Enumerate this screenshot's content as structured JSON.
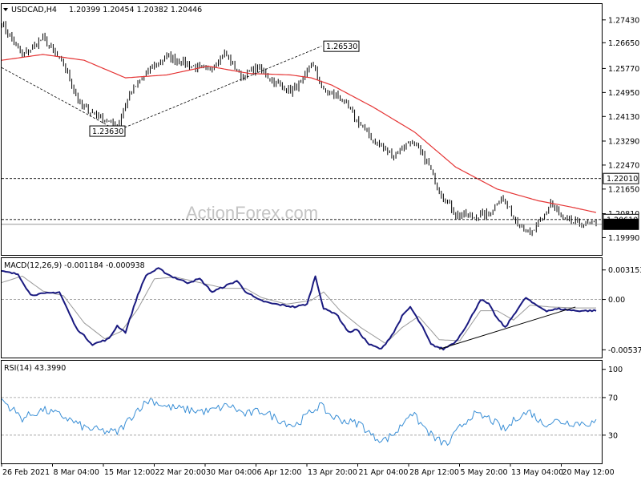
{
  "header": {
    "symbol": "USDCAD,H4",
    "ohlc": "1.20399 1.20454 1.20382 1.20446"
  },
  "watermark": "ActionForex.com",
  "chart_data": [
    {
      "type": "candlestick",
      "ylim": [
        1.194,
        1.28
      ],
      "y_ticks": [
        "1.27430",
        "1.26650",
        "1.25770",
        "1.24950",
        "1.24130",
        "1.23290",
        "1.22470",
        "1.21650",
        "1.20810",
        "1.19990"
      ],
      "y_tick_values": [
        1.2743,
        1.2665,
        1.2577,
        1.2495,
        1.2413,
        1.2329,
        1.2247,
        1.2165,
        1.2081,
        1.1999
      ],
      "x_labels": [
        "26 Feb 2021",
        "8 Mar 04:00",
        "15 Mar 12:00",
        "22 Mar 20:00",
        "30 Mar 04:00",
        "6 Apr 12:00",
        "13 Apr 20:00",
        "21 Apr 04:00",
        "28 Apr 12:00",
        "5 May 20:00",
        "13 May 04:00",
        "20 May 12:00"
      ],
      "price_waypoints": [
        [
          0,
          1.273
        ],
        [
          10,
          1.262
        ],
        [
          20,
          1.268
        ],
        [
          30,
          1.259
        ],
        [
          38,
          1.245
        ],
        [
          48,
          1.241
        ],
        [
          56,
          1.238
        ],
        [
          62,
          1.249
        ],
        [
          70,
          1.256
        ],
        [
          80,
          1.262
        ],
        [
          90,
          1.259
        ],
        [
          100,
          1.257
        ],
        [
          108,
          1.263
        ],
        [
          116,
          1.255
        ],
        [
          124,
          1.258
        ],
        [
          132,
          1.253
        ],
        [
          140,
          1.25
        ],
        [
          146,
          1.253
        ],
        [
          150,
          1.26
        ],
        [
          156,
          1.25
        ],
        [
          164,
          1.248
        ],
        [
          172,
          1.24
        ],
        [
          180,
          1.233
        ],
        [
          190,
          1.228
        ],
        [
          198,
          1.233
        ],
        [
          206,
          1.226
        ],
        [
          212,
          1.216
        ],
        [
          220,
          1.208
        ],
        [
          228,
          1.207
        ],
        [
          236,
          1.208
        ],
        [
          242,
          1.214
        ],
        [
          248,
          1.207
        ],
        [
          256,
          1.201
        ],
        [
          262,
          1.206
        ],
        [
          266,
          1.212
        ],
        [
          272,
          1.206
        ],
        [
          278,
          1.205
        ],
        [
          288,
          1.2045
        ]
      ],
      "moving_average": [
        [
          0,
          1.2605
        ],
        [
          20,
          1.2625
        ],
        [
          40,
          1.2605
        ],
        [
          60,
          1.2545
        ],
        [
          80,
          1.2555
        ],
        [
          100,
          1.2585
        ],
        [
          120,
          1.256
        ],
        [
          140,
          1.2555
        ],
        [
          150,
          1.2545
        ],
        [
          160,
          1.252
        ],
        [
          180,
          1.2445
        ],
        [
          200,
          1.236
        ],
        [
          220,
          1.224
        ],
        [
          240,
          1.2165
        ],
        [
          260,
          1.2125
        ],
        [
          275,
          1.2105
        ],
        [
          288,
          1.2085
        ]
      ],
      "annotations": [
        {
          "text": "1.26530",
          "value": 1.2653
        },
        {
          "text": "1.23630",
          "value": 1.2363
        }
      ],
      "trendlines": [
        {
          "from": [
            0,
            1.258
          ],
          "to": [
            56,
            1.2365
          ],
          "style": "dashed"
        },
        {
          "from": [
            56,
            1.2365
          ],
          "to": [
            155,
            1.2653
          ],
          "style": "dashed"
        }
      ],
      "horizontal_levels": [
        {
          "value": 1.2201,
          "text": "1.22010",
          "style": "dashed",
          "tag": "outlined"
        },
        {
          "value": 1.2061,
          "text": "1.20610",
          "style": "dashed",
          "tag": "outlined"
        },
        {
          "value": 1.20446,
          "text": "1.20446",
          "style": "solid",
          "tag": "filled"
        }
      ]
    },
    {
      "type": "line",
      "title": "MACD(12,26,9) -0.001184 -0.000938",
      "ylim": [
        -0.0062,
        0.0045
      ],
      "y_ticks": [
        "0.003153",
        "0.00",
        "-0.005373"
      ],
      "y_tick_values": [
        0.003153,
        0.0,
        -0.005373
      ],
      "series": [
        {
          "name": "MACD",
          "color": "#1a1a80",
          "waypoints": [
            [
              0,
              0.003
            ],
            [
              8,
              0.0027
            ],
            [
              14,
              0.0005
            ],
            [
              20,
              0.0006
            ],
            [
              28,
              0.0008
            ],
            [
              36,
              -0.003
            ],
            [
              44,
              -0.0048
            ],
            [
              52,
              -0.0042
            ],
            [
              56,
              -0.0028
            ],
            [
              60,
              -0.0035
            ],
            [
              66,
              0.0005
            ],
            [
              70,
              0.0026
            ],
            [
              76,
              0.0033
            ],
            [
              82,
              0.0025
            ],
            [
              90,
              0.0018
            ],
            [
              96,
              0.0022
            ],
            [
              102,
              0.0008
            ],
            [
              108,
              0.0014
            ],
            [
              114,
              0.002
            ],
            [
              118,
              0.0009
            ],
            [
              124,
              0.0
            ],
            [
              130,
              -0.0004
            ],
            [
              136,
              -0.0006
            ],
            [
              142,
              -0.0008
            ],
            [
              148,
              -0.0005
            ],
            [
              152,
              0.0025
            ],
            [
              156,
              -0.001
            ],
            [
              162,
              -0.0015
            ],
            [
              168,
              -0.0035
            ],
            [
              172,
              -0.0032
            ],
            [
              178,
              -0.0048
            ],
            [
              184,
              -0.0053
            ],
            [
              190,
              -0.0035
            ],
            [
              194,
              -0.0018
            ],
            [
              198,
              -0.0008
            ],
            [
              204,
              -0.003
            ],
            [
              208,
              -0.0048
            ],
            [
              214,
              -0.0053
            ],
            [
              220,
              -0.0045
            ],
            [
              226,
              -0.0025
            ],
            [
              232,
              0.0
            ],
            [
              236,
              -0.0005
            ],
            [
              240,
              -0.002
            ],
            [
              244,
              -0.003
            ],
            [
              250,
              -0.001
            ],
            [
              254,
              0.0002
            ],
            [
              258,
              -0.0005
            ],
            [
              264,
              -0.0012
            ],
            [
              270,
              -0.001
            ],
            [
              278,
              -0.0012
            ]
          ]
        },
        {
          "name": "Signal",
          "color": "#9a9a9a",
          "waypoints": [
            [
              0,
              0.0018
            ],
            [
              10,
              0.0025
            ],
            [
              20,
              0.0009
            ],
            [
              30,
              0.0004
            ],
            [
              40,
              -0.0025
            ],
            [
              50,
              -0.0042
            ],
            [
              58,
              -0.0034
            ],
            [
              66,
              -0.001
            ],
            [
              74,
              0.0022
            ],
            [
              84,
              0.0024
            ],
            [
              96,
              0.0018
            ],
            [
              108,
              0.0012
            ],
            [
              118,
              0.0012
            ],
            [
              126,
              0.0002
            ],
            [
              138,
              -0.0005
            ],
            [
              150,
              -0.0001
            ],
            [
              156,
              0.0008
            ],
            [
              164,
              -0.0012
            ],
            [
              174,
              -0.003
            ],
            [
              186,
              -0.0047
            ],
            [
              194,
              -0.003
            ],
            [
              202,
              -0.0018
            ],
            [
              212,
              -0.0043
            ],
            [
              222,
              -0.0044
            ],
            [
              232,
              -0.0012
            ],
            [
              240,
              -0.0012
            ],
            [
              248,
              -0.0022
            ],
            [
              256,
              -0.0006
            ],
            [
              266,
              -0.0008
            ],
            [
              278,
              -0.0009
            ]
          ]
        }
      ],
      "trendlines": [
        {
          "from": [
            212,
            -0.0053
          ],
          "to": [
            278,
            -0.0008
          ],
          "style": "solid"
        }
      ]
    },
    {
      "type": "line",
      "title": "RSI(14) 43.3990",
      "ylim": [
        0,
        100
      ],
      "y_ticks": [
        "100",
        "70",
        "30",
        "0"
      ],
      "y_tick_values": [
        100,
        70,
        30,
        0
      ],
      "levels": [
        70,
        30
      ],
      "series": [
        {
          "name": "RSI",
          "color": "#3a8fd6",
          "waypoints": [
            [
              0,
              68
            ],
            [
              10,
              48
            ],
            [
              20,
              57
            ],
            [
              30,
              50
            ],
            [
              40,
              38
            ],
            [
              50,
              34
            ],
            [
              56,
              33
            ],
            [
              60,
              42
            ],
            [
              66,
              58
            ],
            [
              72,
              68
            ],
            [
              80,
              60
            ],
            [
              90,
              57
            ],
            [
              100,
              55
            ],
            [
              110,
              62
            ],
            [
              118,
              52
            ],
            [
              126,
              56
            ],
            [
              134,
              47
            ],
            [
              142,
              40
            ],
            [
              150,
              55
            ],
            [
              154,
              62
            ],
            [
              160,
              50
            ],
            [
              168,
              44
            ],
            [
              174,
              42
            ],
            [
              180,
              28
            ],
            [
              186,
              25
            ],
            [
              192,
              35
            ],
            [
              198,
              55
            ],
            [
              204,
              40
            ],
            [
              210,
              26
            ],
            [
              216,
              20
            ],
            [
              222,
              38
            ],
            [
              228,
              52
            ],
            [
              236,
              48
            ],
            [
              244,
              35
            ],
            [
              250,
              50
            ],
            [
              256,
              55
            ],
            [
              262,
              42
            ],
            [
              268,
              45
            ],
            [
              278,
              43
            ]
          ]
        }
      ]
    }
  ]
}
